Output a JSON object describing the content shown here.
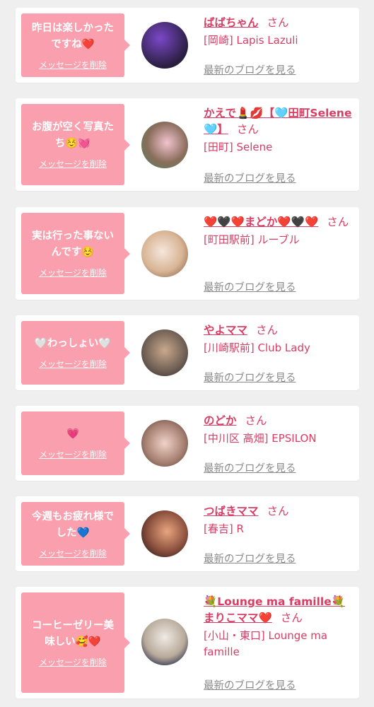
{
  "cards": [
    {
      "message": "昨日は楽しかった\nですね❤️",
      "delete_label": "メッセージを削除",
      "name": "ばばちゃん",
      "honorific": "さん",
      "shop": "[岡崎] Lapis Lazuli",
      "blog_link": "最新のブログを見る",
      "avatar_colors": [
        "#1c1a2e",
        "#6a35b0"
      ]
    },
    {
      "message": "お腹が空く写真た\nち☺️💓",
      "delete_label": "メッセージを削除",
      "name": "かえで💄💋【🩵田町Selene🩵】",
      "honorific": "さん",
      "shop": "[田町] Selene",
      "blog_link": "最新のブログを見る",
      "avatar_colors": [
        "#e9b9c6",
        "#6b8f6b"
      ]
    },
    {
      "message": "実は行った事ない\nんです☺️",
      "delete_label": "メッセージを削除",
      "name": "❤️🖤❤️まどか❤️🖤❤️",
      "honorific": "さん",
      "shop": "[町田駅前] ルーブル",
      "blog_link": "最新のブログを見る",
      "avatar_colors": [
        "#f1ddd2",
        "#c9a37c"
      ]
    },
    {
      "message": "🤍わっしょい🤍",
      "delete_label": "メッセージを削除",
      "name": "やよママ",
      "honorific": "さん",
      "shop": "[川崎駅前] Club Lady",
      "blog_link": "最新のブログを見る",
      "avatar_colors": [
        "#cdb6a0",
        "#5a4d44"
      ]
    },
    {
      "message": "💗",
      "delete_label": "メッセージを削除",
      "name": "のどか",
      "honorific": "さん",
      "shop": "[中川区 高畑] EPSILON",
      "blog_link": "最新のブログを見る",
      "avatar_colors": [
        "#e8c7bd",
        "#7a5a4e"
      ]
    },
    {
      "message": "今週もお疲れ様で\nした💙",
      "delete_label": "メッセージを削除",
      "name": "つばきママ",
      "honorific": "さん",
      "shop": "[春吉] R",
      "blog_link": "最新のブログを見る",
      "avatar_colors": [
        "#d98b6b",
        "#3a2522"
      ]
    },
    {
      "message": "コーヒーゼリー美\n味しい🥰❤️",
      "delete_label": "メッセージを削除",
      "name": "💐Lounge ma famille💐まりこママ❤️",
      "honorific": "さん",
      "shop": "[小山・東口] Lounge ma famille",
      "blog_link": "最新のブログを見る",
      "avatar_colors": [
        "#e9e4de",
        "#2a2f4a"
      ]
    }
  ]
}
